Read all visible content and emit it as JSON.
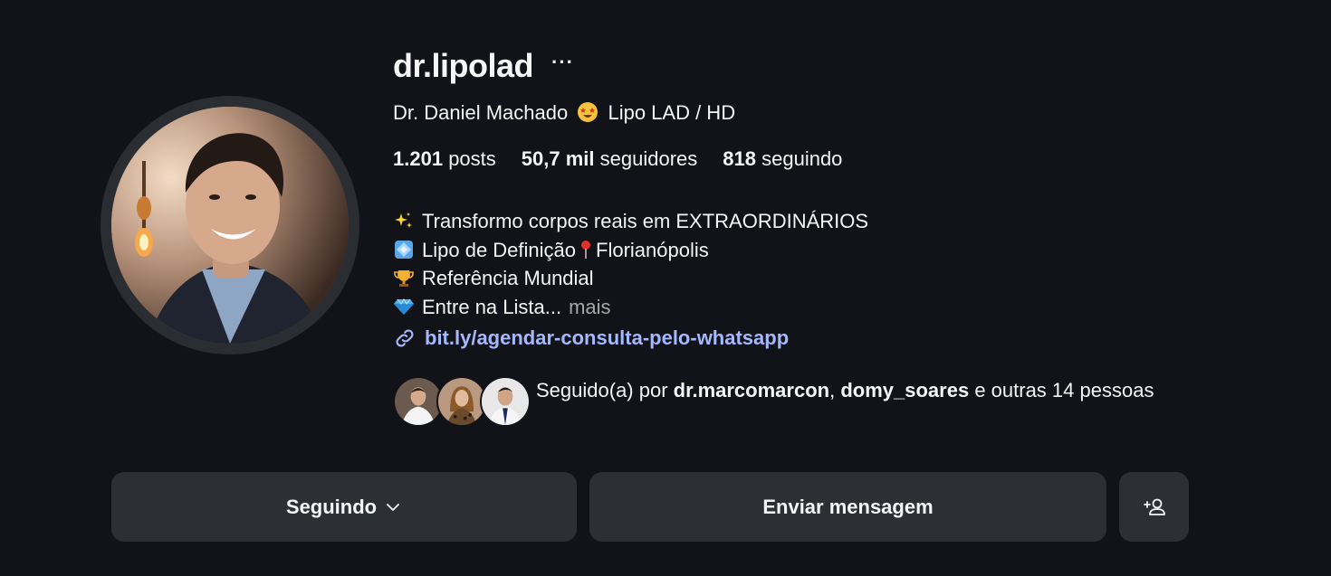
{
  "profile": {
    "username": "dr.lipolad",
    "more_label": "···",
    "fullname_part1": "Dr. Daniel Machado",
    "fullname_part2": "Lipo LAD / HD"
  },
  "stats": {
    "posts_value": "1.201",
    "posts_label": "posts",
    "followers_value": "50,7 mil",
    "followers_label": "seguidores",
    "following_value": "818",
    "following_label": "seguindo"
  },
  "bio": {
    "line1": "Transformo corpos reais em EXTRAORDINÁRIOS",
    "line2_a": "Lipo de Definição",
    "line2_b": "Florianópolis",
    "line3": "Referência Mundial",
    "line4": "Entre na Lista...",
    "more": "mais",
    "icons": [
      "sparkles-icon",
      "diamond-shape-icon",
      "pin-icon",
      "trophy-icon",
      "gem-icon"
    ]
  },
  "link": {
    "text": "bit.ly/agendar-consulta-pelo-whatsapp",
    "color": "#a5b8ff"
  },
  "followed_by": {
    "prefix": "Seguido(a) por",
    "user1": "dr.marcomarcon",
    "separator": ",",
    "user2": "domy_soares",
    "suffix": "e outras 14 pessoas"
  },
  "actions": {
    "following_label": "Seguindo",
    "message_label": "Enviar mensagem"
  },
  "colors": {
    "background": "#121318",
    "button_bg": "#2c3035",
    "muted_text": "#a8a8a8"
  }
}
